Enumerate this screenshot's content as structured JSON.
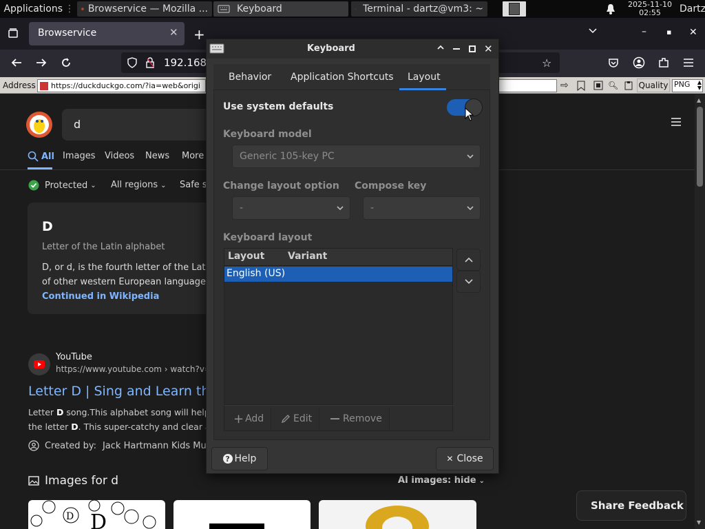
{
  "panel": {
    "applications": "Applications",
    "tasks": [
      {
        "label": "Browservice — Mozilla ..."
      },
      {
        "label": "Keyboard"
      },
      {
        "label": "Terminal - dartz@vm3: ~"
      }
    ],
    "date": "2025-11-10",
    "time": "02:55",
    "user": "Dartz"
  },
  "browser": {
    "tab_title": "Browservice",
    "url_fragment": "192.168.",
    "address_label": "Address",
    "address_url": "https://duckduckgo.com/?ia=web&origi",
    "quality_label": "Quality",
    "quality_value": "PNG"
  },
  "ddg": {
    "query": "d",
    "tabs": [
      "All",
      "Images",
      "Videos",
      "News",
      "More"
    ],
    "protected": "Protected",
    "regions": "All regions",
    "safe": "Safe s",
    "card": {
      "title": "D",
      "subtitle": "Letter of the Latin alphabet",
      "text1": "D, or d, is the fourth letter of the Latin a",
      "text2": "of other western European languages a",
      "more": "Continued in Wikipedia"
    },
    "result": {
      "source": "YouTube",
      "url": "https://www.youtube.com › watch?v=",
      "title": "Letter D | Sing and Learn th",
      "snippet1_a": "Letter ",
      "snippet1_b": "D",
      "snippet1_c": " song.This alphabet song will help",
      "snippet2_a": "the letter ",
      "snippet2_b": "D",
      "snippet2_c": ". This super-catchy and clear al",
      "created_label": "Created by:",
      "created_value": "Jack Hartmann Kids Musi"
    },
    "images_heading": "Images for d",
    "ai_images": "AI images: hide",
    "share_feedback": "Share Feedback"
  },
  "dialog": {
    "title": "Keyboard",
    "tabs": [
      "Behavior",
      "Application Shortcuts",
      "Layout"
    ],
    "active_tab": "Layout",
    "use_defaults": "Use system defaults",
    "use_defaults_on": true,
    "model_label": "Keyboard model",
    "model_value": "Generic 105-key PC",
    "change_option_label": "Change layout option",
    "change_option_value": "-",
    "compose_label": "Compose key",
    "compose_value": "-",
    "layout_label": "Keyboard layout",
    "columns": [
      "Layout",
      "Variant"
    ],
    "layouts": [
      {
        "layout": "English (US)",
        "variant": ""
      }
    ],
    "add": "Add",
    "edit": "Edit",
    "remove": "Remove",
    "help": "Help",
    "close": "Close"
  },
  "colors": {
    "accent": "#1c5fb4",
    "link": "#7eb6ff",
    "panel": "#0b0b0c"
  }
}
